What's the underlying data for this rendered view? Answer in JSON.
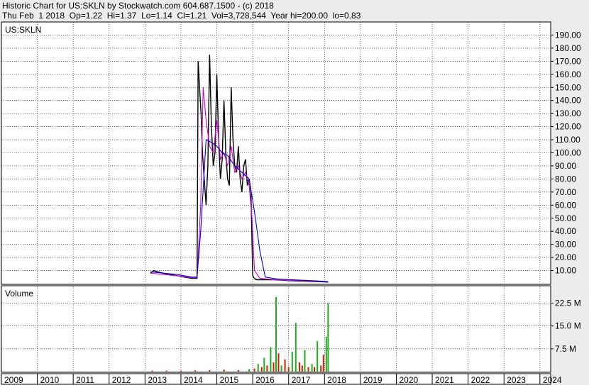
{
  "header": {
    "line1": "Historic Chart for US:SKLN by Stockwatch.com 604.687.1500 - (c) 2018",
    "line2": "Thu Feb  1 2018  Op=1.22  Hi=1.37  Lo=1.14  Cl=1.21  Vol=3,728,544  Year hi=200.00  lo=0.83"
  },
  "colors": {
    "price": "#000000",
    "ma_short": "#cc00cc",
    "ma_long": "#0000cc",
    "vol_up": "#22aa22",
    "vol_down": "#cc2200",
    "grid": "#000000"
  },
  "chart_data": [
    {
      "type": "line",
      "title": "US:SKLN",
      "ylim": [
        0,
        200
      ],
      "yticks": [
        10,
        20,
        30,
        40,
        50,
        60,
        70,
        80,
        90,
        100,
        110,
        120,
        130,
        140,
        150,
        160,
        170,
        180,
        190
      ],
      "ytick_labels": [
        "10.00",
        "20.00",
        "30.00",
        "40.00",
        "50.00",
        "60.00",
        "70.00",
        "80.00",
        "90.00",
        "100.00",
        "110.00",
        "120.00",
        "130.00",
        "140.00",
        "150.00",
        "160.00",
        "170.00",
        "180.00",
        "190.00"
      ],
      "x_domain": [
        2009,
        2024.3
      ],
      "series": [
        {
          "x": [
            2013.15,
            2013.25,
            2013.35,
            2013.5,
            2013.7,
            2013.9,
            2014.1,
            2014.3,
            2014.45,
            2014.48,
            2014.52,
            2014.56,
            2014.6,
            2014.65,
            2014.7,
            2014.75,
            2014.8,
            2014.85,
            2014.9,
            2014.95,
            2015.0,
            2015.05,
            2015.1,
            2015.15,
            2015.2,
            2015.25,
            2015.3,
            2015.35,
            2015.4,
            2015.45,
            2015.5,
            2015.55,
            2015.6,
            2015.65,
            2015.7,
            2015.75,
            2015.8,
            2015.85,
            2015.9,
            2015.95,
            2016.0,
            2016.05,
            2016.1,
            2016.3,
            2016.6,
            2016.9,
            2017.2,
            2017.5,
            2017.8,
            2018.1
          ],
          "y": [
            8,
            10,
            9,
            8,
            7,
            6,
            5,
            4,
            4,
            170,
            150,
            130,
            100,
            80,
            60,
            90,
            175,
            120,
            90,
            100,
            160,
            110,
            80,
            95,
            140,
            100,
            80,
            75,
            150,
            110,
            90,
            85,
            105,
            80,
            70,
            90,
            95,
            75,
            80,
            70,
            6,
            4,
            3,
            3,
            3,
            2.5,
            2,
            1.8,
            1.5,
            1.2
          ]
        },
        {
          "x": [
            2013.15,
            2013.5,
            2013.9,
            2014.3,
            2014.45,
            2014.55,
            2014.62,
            2014.7,
            2014.8,
            2014.9,
            2015.0,
            2015.1,
            2015.2,
            2015.3,
            2015.4,
            2015.5,
            2015.6,
            2015.7,
            2015.8,
            2015.9,
            2015.98,
            2016.05,
            2016.2,
            2016.6,
            2017.0,
            2017.5,
            2018.1
          ],
          "y": [
            8,
            7,
            6,
            4.5,
            4.5,
            60,
            150,
            125,
            105,
            100,
            125,
            95,
            100,
            90,
            105,
            85,
            90,
            80,
            85,
            75,
            50,
            10,
            4,
            3,
            2.5,
            2,
            1.5
          ]
        },
        {
          "x": [
            2013.15,
            2013.5,
            2013.9,
            2014.3,
            2014.45,
            2014.55,
            2014.7,
            2014.85,
            2015.0,
            2015.15,
            2015.3,
            2015.5,
            2015.7,
            2015.9,
            2016.05,
            2016.2,
            2016.35,
            2016.7,
            2017.2,
            2017.7,
            2018.1
          ],
          "y": [
            9,
            8,
            7,
            5,
            5,
            40,
            110,
            108,
            105,
            100,
            98,
            90,
            85,
            80,
            55,
            25,
            5,
            3.5,
            2.8,
            2.2,
            1.5
          ]
        }
      ]
    },
    {
      "type": "bar",
      "title": "Volume",
      "ylim": [
        0,
        28
      ],
      "yticks": [
        7.5,
        15,
        22.5
      ],
      "ytick_labels": [
        "7.5 M",
        "15.0 M",
        "22.5 M"
      ],
      "x_domain": [
        2009,
        2024.3
      ],
      "x": [
        2013.2,
        2013.6,
        2014.0,
        2014.4,
        2014.8,
        2015.2,
        2015.6,
        2015.9,
        2016.05,
        2016.15,
        2016.25,
        2016.32,
        2016.4,
        2016.5,
        2016.58,
        2016.65,
        2016.72,
        2016.8,
        2016.9,
        2017.0,
        2017.1,
        2017.2,
        2017.3,
        2017.38,
        2017.45,
        2017.55,
        2017.65,
        2017.72,
        2017.8,
        2017.9,
        2017.97,
        2018.05,
        2018.1
      ],
      "values": [
        0.3,
        0.3,
        0.3,
        0.4,
        0.5,
        0.6,
        0.5,
        0.8,
        1.0,
        2.5,
        1.5,
        4.5,
        2.0,
        8.0,
        3.0,
        24.5,
        6.0,
        2.0,
        4.0,
        1.5,
        6.5,
        16.0,
        3.0,
        2.0,
        7.0,
        1.5,
        2.5,
        1.5,
        10.0,
        2.0,
        5.5,
        11.5,
        22.5
      ],
      "colors": [
        "r",
        "r",
        "r",
        "r",
        "r",
        "r",
        "r",
        "g",
        "r",
        "g",
        "r",
        "g",
        "r",
        "g",
        "r",
        "g",
        "r",
        "g",
        "r",
        "r",
        "g",
        "g",
        "r",
        "r",
        "g",
        "r",
        "g",
        "r",
        "g",
        "r",
        "r",
        "g",
        "g"
      ]
    }
  ],
  "xaxis": {
    "years": [
      "2009",
      "2010",
      "2011",
      "2012",
      "2013",
      "2014",
      "2015",
      "2016",
      "2017",
      "2018",
      "2019",
      "2020",
      "2021",
      "2022",
      "2023",
      "2024"
    ]
  }
}
